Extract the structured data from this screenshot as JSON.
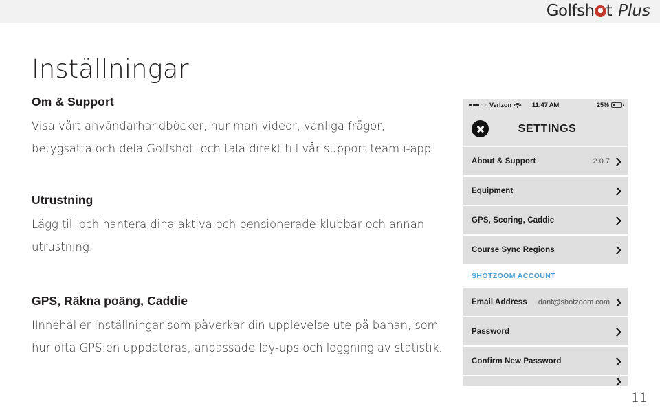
{
  "header": {
    "logo_text_1": "Golf",
    "logo_text_2": "sh",
    "logo_text_3": "t",
    "logo_plus": "Plus",
    "logo_full": "Golfshot Plus",
    "accent_red": "#c0392b",
    "band_color": "#f2f2f2"
  },
  "page": {
    "title": "Inställningar",
    "number": "11"
  },
  "sections": [
    {
      "heading": "Om & Support",
      "body": "Visa vårt användarhandböcker, hur man videor, vanliga frågor, betygsätta och dela Golfshot, och tala direkt till vår support team i-app."
    },
    {
      "heading": "Utrustning",
      "body": "Lägg till och hantera dina aktiva och pensionerade klubbar och annan utrustning."
    },
    {
      "heading": "GPS, Räkna poäng, Caddie",
      "body": "IInnehåller inställningar som påverkar din upplevelse ute på banan, som hur ofta GPS:en uppdateras, anpassade lay-ups och loggning av statistik."
    }
  ],
  "phone": {
    "status_bar": {
      "carrier": "Verizon",
      "signal_filled_dots": 3,
      "signal_hollow_dots": 2,
      "wifi_icon": "wifi-icon",
      "time": "11:47 AM",
      "battery_percent": "25%",
      "battery_level": 25
    },
    "nav": {
      "close_icon": "close-circle-icon",
      "title": "SETTINGS"
    },
    "rows": [
      {
        "label": "About & Support",
        "value": "2.0.7",
        "chevron": "chevron-right-icon"
      },
      {
        "label": "Equipment",
        "value": "",
        "chevron": "chevron-right-icon"
      },
      {
        "label": "GPS, Scoring, Caddie",
        "value": "",
        "chevron": "chevron-right-icon"
      },
      {
        "label": "Course Sync Regions",
        "value": "",
        "chevron": "chevron-right-icon"
      }
    ],
    "section_header": {
      "label": "SHOTZOOM ACCOUNT",
      "color": "#4a9fd4"
    },
    "account_rows": [
      {
        "label": "Email Address",
        "value": "danf@shotzoom.com",
        "chevron": "chevron-right-icon"
      },
      {
        "label": "Password",
        "value": "",
        "chevron": "chevron-right-icon"
      },
      {
        "label": "Confirm New Password",
        "value": "",
        "chevron": "chevron-right-icon"
      }
    ],
    "cut_off_row": {
      "label": "",
      "value": ""
    }
  }
}
